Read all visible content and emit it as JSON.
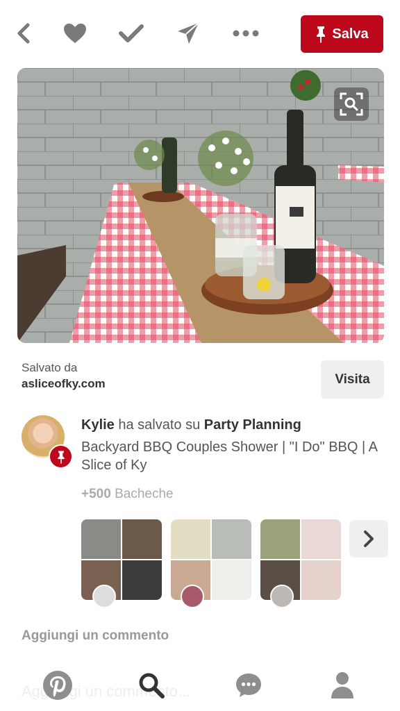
{
  "header": {
    "back_icon": "chevron-left-icon",
    "like_icon": "heart-icon",
    "done_icon": "checkmark-icon",
    "send_icon": "send-icon",
    "more_icon": "more-dots-icon",
    "save_label": "Salva",
    "save_color": "#bd081c"
  },
  "pin": {
    "image_description": "",
    "lens_icon": "visual-search-icon"
  },
  "source": {
    "saved_from_label": "Salvato da",
    "domain": "asliceofky.com",
    "visit_label": "Visita"
  },
  "attribution": {
    "user": "Kylie",
    "action": "ha salvato su",
    "board": "Party Planning",
    "title": "Backyard BBQ Couples Shower | \"I Do\" BBQ | A Slice of Ky"
  },
  "boards": {
    "count": "+500",
    "label": "Bacheche"
  },
  "comments": {
    "heading": "Aggiungi un commento",
    "placeholder": "Aggiungi un commento..."
  },
  "bottom_nav": {
    "home_icon": "pinterest-logo-icon",
    "search_icon": "search-icon",
    "messages_icon": "chat-bubble-icon",
    "profile_icon": "profile-icon"
  }
}
